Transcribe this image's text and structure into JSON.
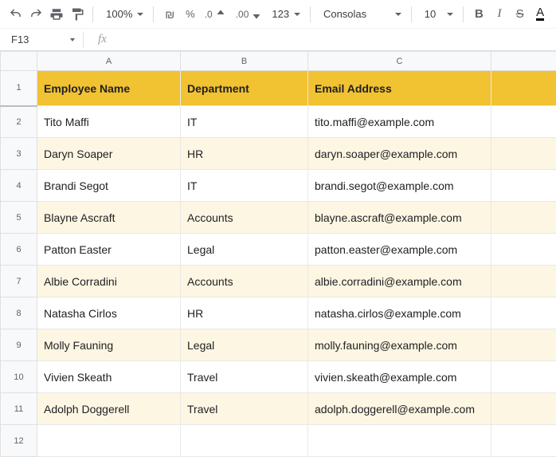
{
  "toolbar": {
    "zoom": "100%",
    "font": "Consolas",
    "font_size": "10",
    "currency_glyph": "₪",
    "percent": "%",
    "dec_dec": ".0",
    "inc_dec": ".00",
    "num_format": "123",
    "bold": "B",
    "italic": "I",
    "strike": "S",
    "textcolor": "A"
  },
  "namebox": {
    "ref": "F13",
    "fx": "fx"
  },
  "columns": [
    "A",
    "B",
    "C",
    ""
  ],
  "header": {
    "name": "Employee Name",
    "dept": "Department",
    "email": "Email Address"
  },
  "rows": [
    {
      "n": "2",
      "name": "Tito Maffi",
      "dept": "IT",
      "email": "tito.maffi@example.com"
    },
    {
      "n": "3",
      "name": "Daryn Soaper",
      "dept": "HR",
      "email": "daryn.soaper@example.com"
    },
    {
      "n": "4",
      "name": "Brandi Segot",
      "dept": "IT",
      "email": "brandi.segot@example.com"
    },
    {
      "n": "5",
      "name": "Blayne Ascraft",
      "dept": "Accounts",
      "email": "blayne.ascraft@example.com"
    },
    {
      "n": "6",
      "name": "Patton Easter",
      "dept": "Legal",
      "email": "patton.easter@example.com"
    },
    {
      "n": "7",
      "name": "Albie Corradini",
      "dept": "Accounts",
      "email": "albie.corradini@example.com"
    },
    {
      "n": "8",
      "name": "Natasha Cirlos",
      "dept": "HR",
      "email": "natasha.cirlos@example.com"
    },
    {
      "n": "9",
      "name": "Molly Fauning",
      "dept": "Legal",
      "email": "molly.fauning@example.com"
    },
    {
      "n": "10",
      "name": "Vivien Skeath",
      "dept": "Travel",
      "email": "vivien.skeath@example.com"
    },
    {
      "n": "11",
      "name": "Adolph Doggerell",
      "dept": "Travel",
      "email": "adolph.doggerell@example.com"
    }
  ],
  "tail_row": "12"
}
